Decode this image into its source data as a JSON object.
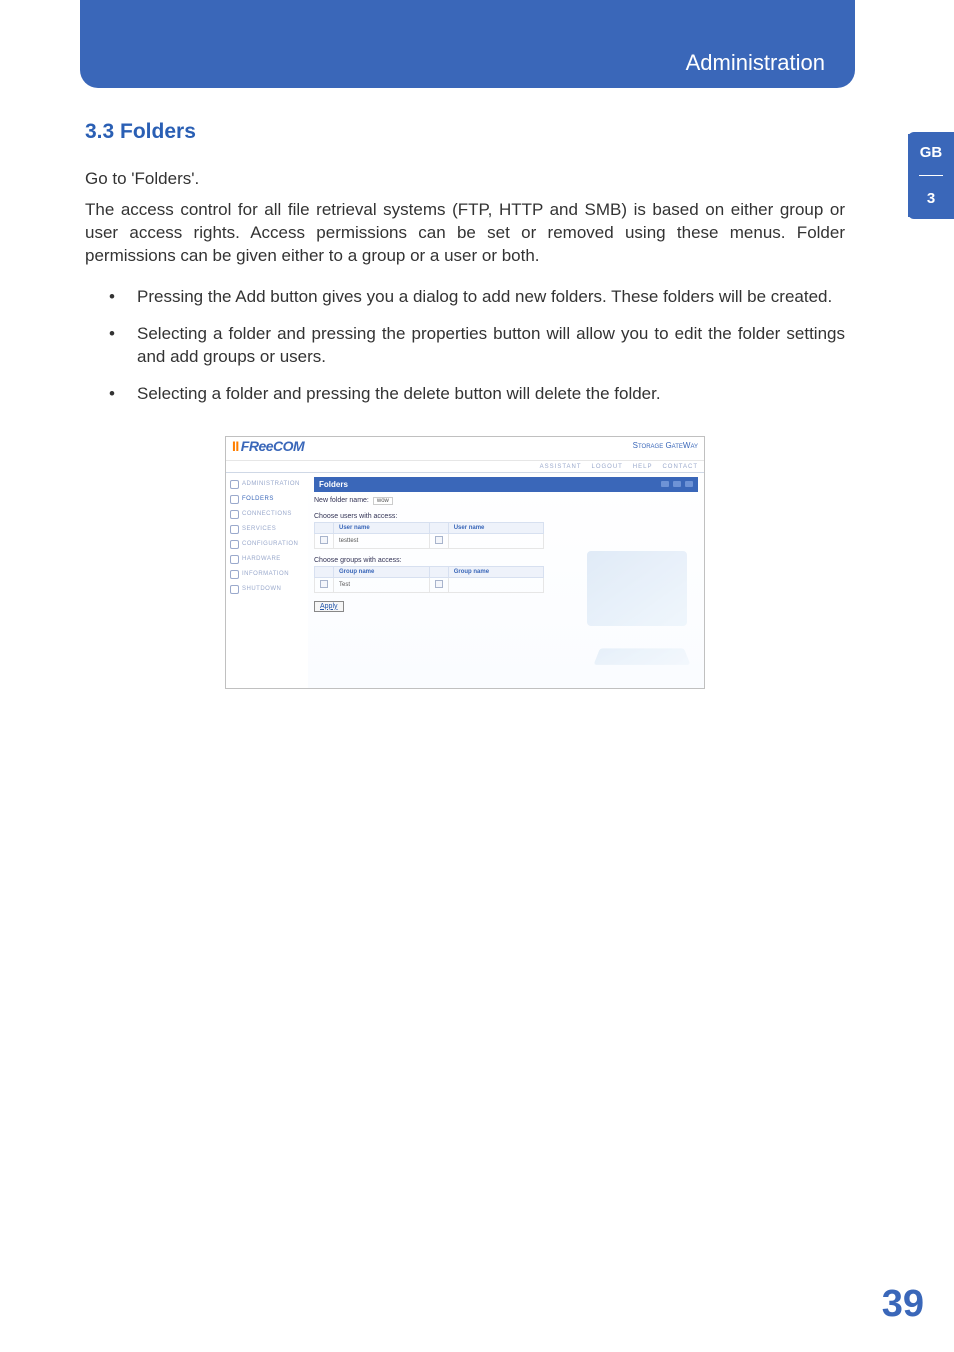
{
  "header": {
    "title": "Administration"
  },
  "side": {
    "lang": "GB",
    "chapter": "3"
  },
  "section": {
    "heading": "3.3  Folders",
    "intro1": "Go to 'Folders'.",
    "intro2": "The access control for all file retrieval systems (FTP, HTTP and SMB) is based on either group or user access rights. Access permissions can be set or removed using these menus. Folder permissions can be given either to a group or a user or both.",
    "bullets": [
      "Pressing the Add button gives you a dialog to add new folders. These folders will be created.",
      "Selecting a folder and pressing the properties button will allow you to edit the folder settings and add groups or users.",
      "Selecting a folder and pressing the delete button will delete the folder."
    ]
  },
  "app": {
    "logo": "FReeCOM",
    "product": "Storage GateWay",
    "links": {
      "assistant": "ASSISTANT",
      "logout": "LOGOUT",
      "help": "HELP",
      "contact": "CONTACT"
    },
    "nav": {
      "items": [
        "ADMINISTRATION",
        "FOLDERS",
        "CONNECTIONS",
        "SERVICES",
        "CONFIGURATION",
        "HARDWARE",
        "INFORMATION",
        "SHUTDOWN"
      ]
    },
    "panel": {
      "title": "Folders",
      "newFolderLabel": "New folder name:",
      "newFolderValue": "wow",
      "usersLabel": "Choose users with access:",
      "groupsLabel": "Choose groups with access:",
      "userCols": [
        "User name",
        "User name"
      ],
      "userRow": [
        "testtest",
        ""
      ],
      "groupCols": [
        "Group name",
        "Group name"
      ],
      "groupRow": [
        "Test",
        ""
      ],
      "apply": "Apply"
    }
  },
  "page": {
    "number": "39"
  }
}
